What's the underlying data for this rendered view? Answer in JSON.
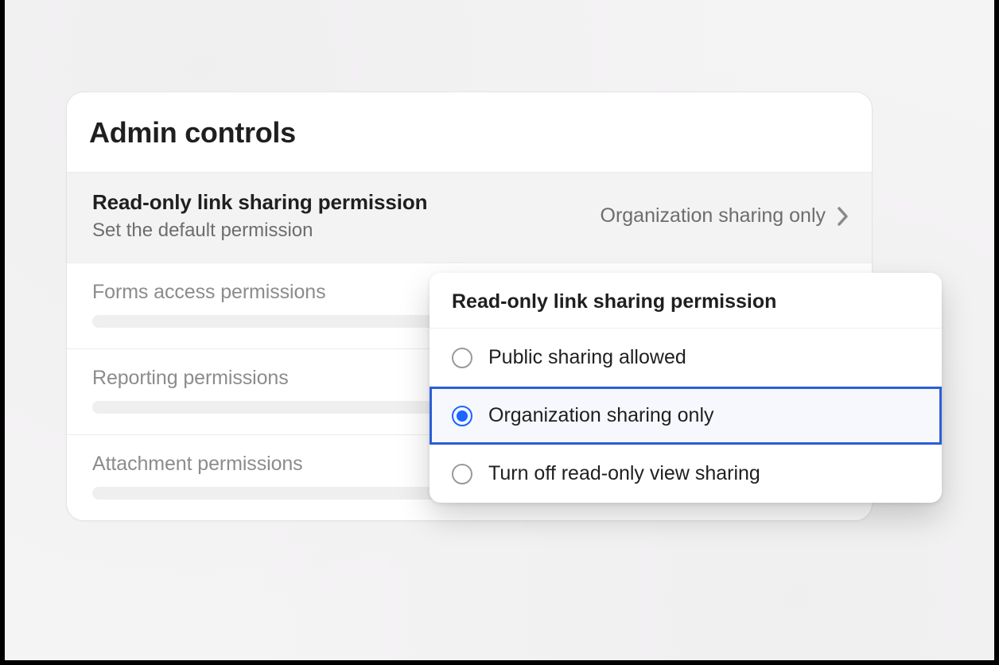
{
  "card": {
    "title": "Admin controls",
    "active_row": {
      "title": "Read-only link sharing permission",
      "subtitle": "Set the default permission",
      "value": "Organization sharing only"
    },
    "muted_rows": [
      {
        "title": "Forms access permissions"
      },
      {
        "title": "Reporting permissions"
      },
      {
        "title": "Attachment permissions"
      }
    ]
  },
  "popover": {
    "title": "Read-only link sharing permission",
    "options": [
      {
        "label": "Public sharing allowed",
        "selected": false
      },
      {
        "label": "Organization sharing only",
        "selected": true
      },
      {
        "label": "Turn off read-only view sharing",
        "selected": false
      }
    ]
  },
  "colors": {
    "accent": "#1a66ff",
    "selected_border": "#2a5fd7"
  }
}
